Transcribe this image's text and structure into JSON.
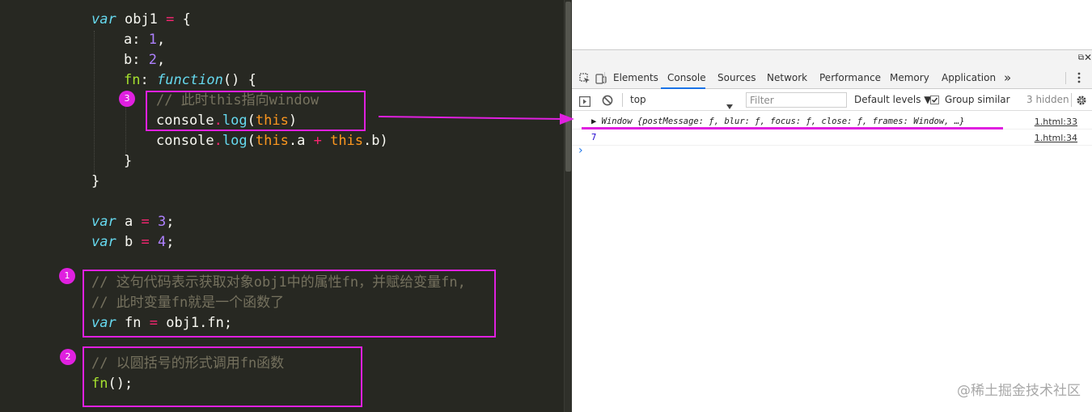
{
  "editor": {
    "tokens": {
      "var": "var",
      "obj1": "obj1",
      "eq": "=",
      "lbrace": "{",
      "rbrace": "}",
      "a_key": "a",
      "b_key": "b",
      "fn_key": "fn",
      "colon": ":",
      "comma": ",",
      "one": "1",
      "two": "2",
      "three": "3",
      "four": "4",
      "function_kw": "function",
      "paren_open_brace": "() {",
      "comment_this_window": "// 此时this指向window",
      "console": "console",
      "dot": ".",
      "log": "log",
      "lparen": "(",
      "rparen": ")",
      "this_kw": "this",
      "prop_a": "a",
      "prop_b": "b",
      "plus": "+",
      "a_var": "a",
      "b_var": "b",
      "fn_var": "fn",
      "semi": ";",
      "obj1_fn": "obj1.fn;",
      "comment_line1": "// 这句代码表示获取对象obj1中的属性fn，并赋给变量fn,",
      "comment_line2": "// 此时变量fn就是一个函数了",
      "comment_call": "// 以圆括号的形式调用fn函数",
      "fn_call": "fn",
      "call_suffix": "();"
    },
    "badges": [
      "1",
      "2",
      "3"
    ]
  },
  "devtools": {
    "tabs": [
      "Elements",
      "Console",
      "Sources",
      "Network",
      "Performance",
      "Memory",
      "Application"
    ],
    "more_tabs": "»",
    "active_tab": "Console",
    "context": "top",
    "filter_placeholder": "Filter",
    "default_levels": "Default levels ▼",
    "group_similar": "Group similar",
    "hidden_count": "3 hidden",
    "logs": [
      {
        "message": "▶ Window {postMessage: ƒ, blur: ƒ, focus: ƒ, close: ƒ, frames: Window, …}",
        "source": "1.html:33"
      },
      {
        "message": "7",
        "source": "1.html:34"
      }
    ],
    "prompt": "›"
  },
  "watermark": "@稀土掘金技术社区",
  "colors": {
    "editor_bg": "#272822",
    "highlight": "#e020e0",
    "keyword": "#66d9ef",
    "number": "#ae81ff",
    "operator": "#f92672",
    "this": "#fd971f",
    "function_name": "#a6e22e",
    "comment": "#75715e",
    "devtools_accent": "#1a73e8"
  }
}
